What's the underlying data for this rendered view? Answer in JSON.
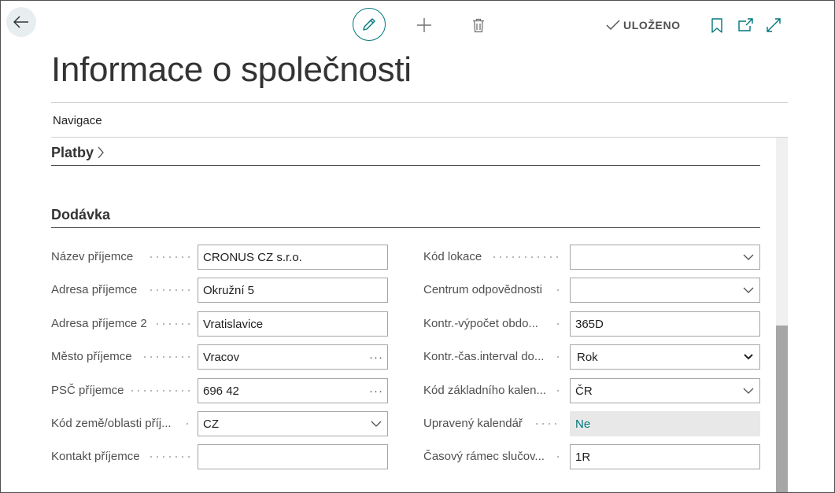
{
  "toolbar": {
    "saved_label": "ULOŽENO"
  },
  "icons": {
    "back": "arrow-left-icon",
    "edit": "pencil-icon",
    "new": "plus-icon",
    "delete": "trash-icon",
    "check": "checkmark-icon",
    "bookmark": "bookmark-icon",
    "open_new": "open-new-window-icon",
    "expand": "expand-icon"
  },
  "page": {
    "title": "Informace o společnosti",
    "navigation_label": "Navigace"
  },
  "sections": {
    "payments": {
      "title": "Platby"
    },
    "shipping": {
      "title": "Dodávka"
    }
  },
  "fields_left": [
    {
      "label": "Název příjemce",
      "value": "CRONUS CZ s.r.o.",
      "control": "text"
    },
    {
      "label": "Adresa příjemce",
      "value": "Okružní 5",
      "control": "text"
    },
    {
      "label": "Adresa příjemce 2",
      "value": "Vratislavice",
      "control": "text"
    },
    {
      "label": "Město příjemce",
      "value": "Vracov",
      "control": "lookup"
    },
    {
      "label": "PSČ příjemce",
      "value": "696 42",
      "control": "lookup"
    },
    {
      "label": "Kód země/oblasti příj...",
      "value": "CZ",
      "control": "dropdown"
    },
    {
      "label": "Kontakt příjemce",
      "value": "",
      "control": "text"
    }
  ],
  "fields_right": [
    {
      "label": "Kód lokace",
      "value": "",
      "control": "dropdown"
    },
    {
      "label": "Centrum odpovědnosti",
      "value": "",
      "control": "dropdown"
    },
    {
      "label": "Kontr.-výpočet obdo...",
      "value": "365D",
      "control": "text"
    },
    {
      "label": "Kontr.-čas.interval do...",
      "value": "Rok",
      "control": "select"
    },
    {
      "label": "Kód základního kalen...",
      "value": "ČR",
      "control": "dropdown"
    },
    {
      "label": "Upravený kalendář",
      "value": "Ne",
      "control": "readonly"
    },
    {
      "label": "Časový rámec slučov...",
      "value": "1R",
      "control": "text"
    }
  ],
  "lookup_glyph": "···",
  "colors": {
    "accent": "#00767c",
    "frame": "#505050",
    "scroll_thumb": "#a6a6a6"
  }
}
